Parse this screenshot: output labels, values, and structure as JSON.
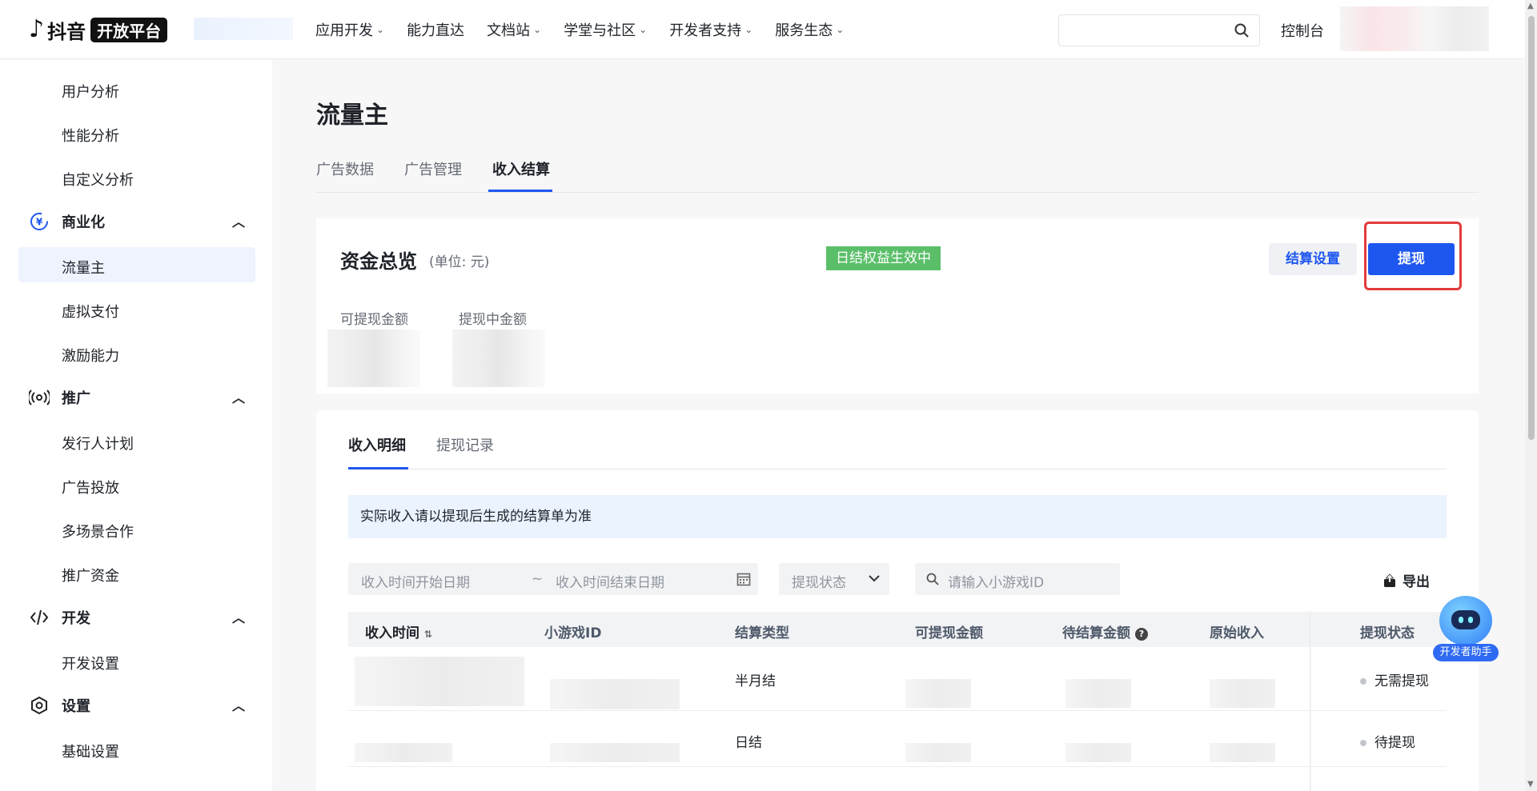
{
  "header": {
    "logo_text": "抖音",
    "logo_badge": "开放平台",
    "nav": [
      {
        "label": "应用开发",
        "has_dropdown": true
      },
      {
        "label": "能力直达",
        "has_dropdown": false
      },
      {
        "label": "文档站",
        "has_dropdown": true
      },
      {
        "label": "学堂与社区",
        "has_dropdown": true
      },
      {
        "label": "开发者支持",
        "has_dropdown": true
      },
      {
        "label": "服务生态",
        "has_dropdown": true
      }
    ],
    "search_placeholder": "",
    "console_label": "控制台"
  },
  "sidebar": {
    "items": [
      {
        "label": "用户分析"
      },
      {
        "label": "性能分析"
      },
      {
        "label": "自定义分析"
      }
    ],
    "groups": [
      {
        "label": "商业化",
        "icon": "yen-icon",
        "children": [
          "流量主",
          "虚拟支付",
          "激励能力"
        ]
      },
      {
        "label": "推广",
        "icon": "broadcast-icon",
        "children": [
          "发行人计划",
          "广告投放",
          "多场景合作",
          "推广资金"
        ]
      },
      {
        "label": "开发",
        "icon": "code-icon",
        "children": [
          "开发设置"
        ]
      },
      {
        "label": "设置",
        "icon": "settings-icon",
        "children": [
          "基础设置"
        ]
      }
    ],
    "active_item": "流量主"
  },
  "page": {
    "title": "流量主",
    "tabs": [
      "广告数据",
      "广告管理",
      "收入结算"
    ],
    "active_tab": "收入结算"
  },
  "funds": {
    "title": "资金总览",
    "unit": "(单位: 元)",
    "badge": "日结权益生效中",
    "settle_button": "结算设置",
    "withdraw_button": "提现",
    "labels": [
      "可提现金额",
      "提现中金额"
    ]
  },
  "detail": {
    "tabs": [
      "收入明细",
      "提现记录"
    ],
    "active_tab": "收入明细",
    "notice": "实际收入请以提现后生成的结算单为准",
    "filters": {
      "start_placeholder": "收入时间开始日期",
      "separator": "~",
      "end_placeholder": "收入时间结束日期",
      "status_placeholder": "提现状态",
      "search_placeholder": "请输入小游戏ID"
    },
    "export_label": "导出",
    "columns": [
      "收入时间",
      "小游戏ID",
      "结算类型",
      "可提现金额",
      "待结算金额",
      "原始收入",
      "提现状态"
    ],
    "rows": [
      {
        "settle_type": "半月结",
        "status": "无需提现"
      },
      {
        "settle_type": "日结",
        "status": "待提现"
      }
    ]
  },
  "assistant": {
    "label": "开发者助手"
  },
  "colors": {
    "accent": "#1e57f0",
    "badge_green": "#5bbf6a",
    "highlight_red": "#e23b3b",
    "notice_bg": "#eaf3fe"
  }
}
